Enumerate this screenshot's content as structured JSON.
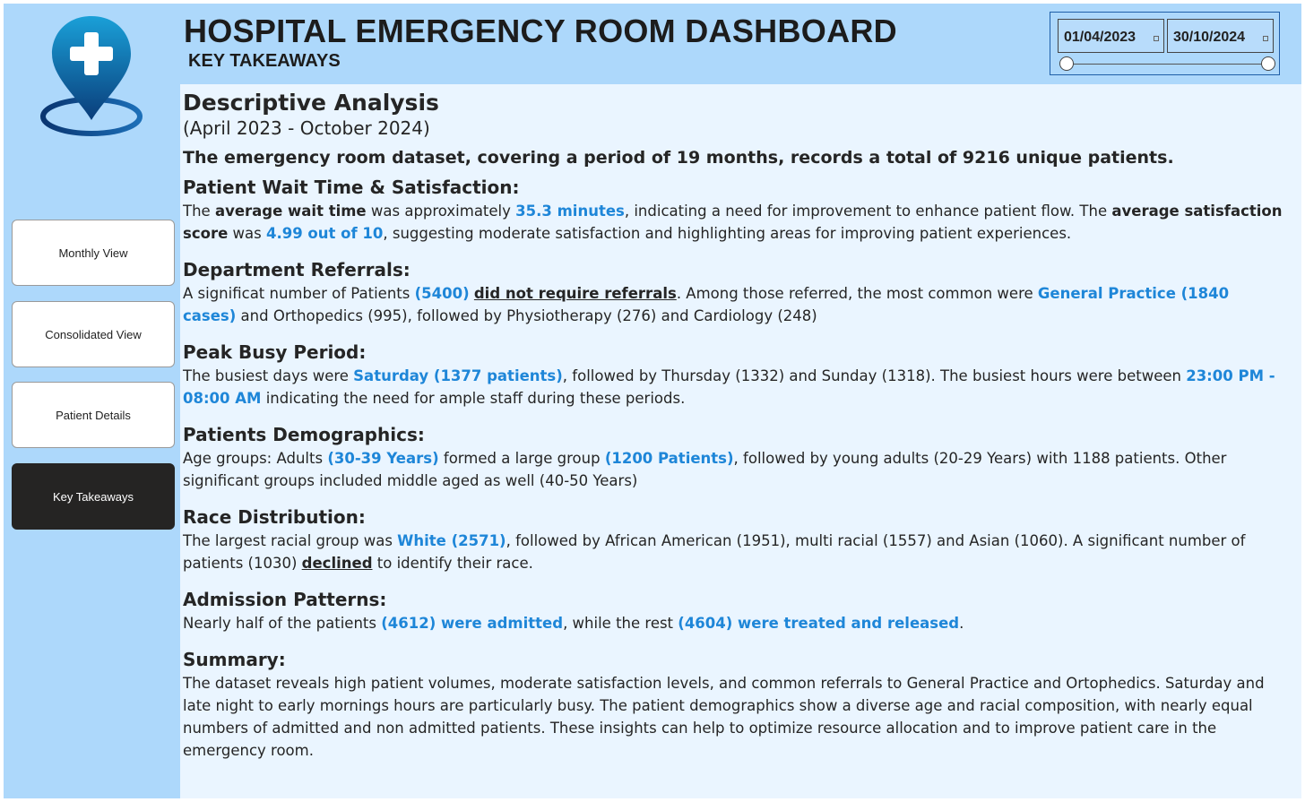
{
  "header": {
    "title": "HOSPITAL EMERGENCY ROOM DASHBOARD",
    "subtitle": "KEY TAKEAWAYS"
  },
  "date_slicer": {
    "start": "01/04/2023",
    "end": "30/10/2024"
  },
  "nav": {
    "items": [
      {
        "label": "Monthly View"
      },
      {
        "label": "Consolidated View"
      },
      {
        "label": "Patient Details"
      },
      {
        "label": "Key Takeaways"
      }
    ],
    "active": "Key Takeaways"
  },
  "colors": {
    "background": "#add8fb",
    "panel": "#eaf5ff",
    "highlight": "#1e86d8",
    "active_nav": "#252423"
  },
  "content": {
    "heading": "Descriptive Analysis",
    "period": "(April 2023 - October 2024)",
    "lead": "The emergency room dataset, covering a period of 19 months, records a total of 9216 unique patients.",
    "wait": {
      "title": "Patient Wait Time & Satisfaction:",
      "t1": "The ",
      "b1": "average wait time",
      "t2": " was approximately ",
      "h1": "35.3 minutes",
      "t3": ", indicating a need for improvement to enhance patient flow. The ",
      "b2": "average satisfaction score",
      "t4": " was ",
      "h2": "4.99 out of 10",
      "t5": ", suggesting moderate satisfaction and highlighting areas for improving patient experiences."
    },
    "referrals": {
      "title": "Department Referrals:",
      "t1": "A significat number of Patients ",
      "h1": "(5400)",
      "t2": " ",
      "u1": "did not require referrals",
      "t3": ". Among those referred, the most common were ",
      "h2": "General Practice (1840 cases)",
      "t4": " and Orthopedics (995), followed by Physiotherapy (276) and Cardiology (248)"
    },
    "peak": {
      "title": "Peak Busy Period:",
      "t1": "The busiest days were ",
      "h1": "Saturday (1377 patients)",
      "t2": ", followed by Thursday (1332) and Sunday (1318). The busiest hours were between ",
      "h2": "23:00 PM - 08:00 AM",
      "t3": " indicating the need for ample staff during these periods."
    },
    "demographics": {
      "title": "Patients Demographics:",
      "t1": "Age groups: Adults ",
      "h1": "(30-39 Years)",
      "t2": " formed a large group ",
      "h2": "(1200 Patients)",
      "t3": ", followed by young adults (20-29 Years) with 1188 patients. Other significant groups included middle aged as well (40-50 Years)"
    },
    "race": {
      "title": "Race Distribution:",
      "t1": "The largest racial group was ",
      "h1": "White (2571)",
      "t2": ", followed by African American (1951), multi racial (1557) and Asian (1060). A significant number of patients (1030) ",
      "u1": "declined",
      "t3": " to identify their race."
    },
    "admission": {
      "title": "Admission Patterns:",
      "t1": "Nearly half of the patients ",
      "h1": "(4612) were admitted",
      "t2": ", while the rest ",
      "h2": "(4604) were treated and released",
      "t3": "."
    },
    "summary": {
      "title": "Summary:",
      "text": "The dataset reveals high patient volumes, moderate satisfaction levels, and common referrals to General Practice and Ortophedics. Saturday and late night to early mornings hours are particularly busy. The patient demographics show a diverse age and racial composition, with nearly equal numbers of admitted and non admitted patients. These insights can help to optimize resource allocation and to improve patient care in the emergency room."
    }
  }
}
